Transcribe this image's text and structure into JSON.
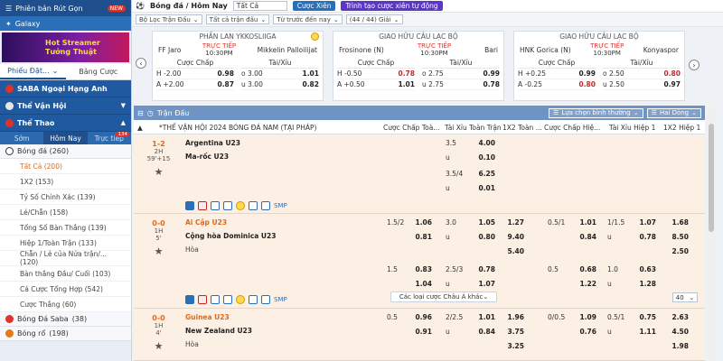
{
  "sidebar": {
    "top_label": "Phiên bản Rút Gọn",
    "top_badge": "NEW",
    "galaxy_label": "Galaxy",
    "banner_line1": "Hot Streamer",
    "banner_line2": "Tưởng Thuật",
    "tabs": [
      {
        "label": "Phiếu Đặt..."
      },
      {
        "label": "Bảng Cược"
      }
    ],
    "groups": [
      {
        "label": "SABA Ngoại Hạng Anh"
      },
      {
        "label": "Thể Vận Hội"
      },
      {
        "label": "Thể Thao"
      }
    ],
    "subtabs": [
      {
        "label": "Sớm"
      },
      {
        "label": "Hôm Nay"
      },
      {
        "label": "Trực tiếp",
        "badge": "134"
      }
    ],
    "sport_main": "Bóng đá (260)",
    "items": [
      {
        "label": "Tất Cả (200)"
      },
      {
        "label": "1X2 (153)"
      },
      {
        "label": "Tỷ Số Chính Xác (139)"
      },
      {
        "label": "Lẻ/Chẵn (158)"
      },
      {
        "label": "Tổng Số Bàn Thắng (139)"
      },
      {
        "label": "Hiệp 1/Toàn Trận (133)"
      },
      {
        "label": "Chẵn / Lẻ của Nửa trận/... (120)"
      },
      {
        "label": "Bàn thắng Đầu/ Cuối (103)"
      },
      {
        "label": "Cá Cược Tổng Hợp (542)"
      },
      {
        "label": "Cược Thắng (60)"
      }
    ],
    "other_sports": [
      {
        "label": "Bóng Đá Saba",
        "count": "(38)"
      },
      {
        "label": "Bóng rổ",
        "count": "(198)"
      }
    ]
  },
  "topbar": {
    "title": "Bóng đá / Hôm Nay",
    "select_all": "Tất Cả",
    "btn_parlay": "Cược Xiên",
    "btn_auto": "Trình tạo cược xiên tự động"
  },
  "filters": {
    "league_filter": "Bộ Lọc Trận Đấu",
    "all_matches": "Tất cả trận đấu",
    "sort": "Từ trước đến nay",
    "count": "(44 / 44) Giải"
  },
  "cards": [
    {
      "league": "PHẦN LAN YKKOSLIIGA",
      "home": "FF Jaro",
      "away": "Mikkelin Palloilijat",
      "live": "TRỰC TIẾP",
      "time": "10:30PM",
      "hdr_hcp": "Cược Chấp",
      "hdr_ou": "Tài/Xỉu",
      "rows": [
        {
          "a": "H -2.00",
          "b": "0.98",
          "c": "o 3.00",
          "d": "1.01"
        },
        {
          "a": "A +2.00",
          "b": "0.87",
          "c": "u 3.00",
          "d": "0.82"
        }
      ]
    },
    {
      "league": "GIAO HỮU CÂU LẠC BỘ",
      "home": "Frosinone (N)",
      "away": "Bari",
      "live": "TRỰC TIẾP",
      "time": "10:30PM",
      "hdr_hcp": "Cược Chấp",
      "hdr_ou": "Tài/Xỉu",
      "rows": [
        {
          "a": "H -0.50",
          "b": "0.78",
          "c": "o 2.75",
          "d": "0.99"
        },
        {
          "a": "A +0.50",
          "b": "1.01",
          "c": "u 2.75",
          "d": "0.78"
        }
      ]
    },
    {
      "league": "GIAO HỮU CÂU LẠC BỘ",
      "home": "HNK Gorica (N)",
      "away": "Konyaspor",
      "live": "TRỰC TIẾP",
      "time": "10:30PM",
      "hdr_hcp": "Cược Chấp",
      "hdr_ou": "Tài/Xỉu",
      "rows": [
        {
          "a": "H +0.25",
          "b": "0.99",
          "c": "o 2.50",
          "d": "0.80"
        },
        {
          "a": "A -0.25",
          "b": "0.80",
          "c": "u 2.50",
          "d": "0.97"
        }
      ]
    }
  ],
  "table": {
    "bar_title": "Trận Đấu",
    "odds_type": "Lựa chọn bình thường",
    "rows_sel": "Hai Dòng",
    "league": "*THẾ VẬN HỘI 2024 BÓNG ĐÁ NAM (TẠI PHÁP)",
    "col_hcp": "Cược Chấp Toà...",
    "col_ou": "Tài Xỉu Toàn Trận",
    "col_1x2": "1X2 Toàn ...",
    "col_hcp1": "Cược Chấp Hiệ...",
    "col_ou1": "Tài Xỉu Hiệp 1",
    "col_1x21": "1X2 Hiệp 1",
    "smp": "SMP",
    "more_label": "Các loại cược Châu Á khác",
    "pager": "40"
  },
  "matches": [
    {
      "score": "1-2",
      "half": "2H",
      "time": "59'+15",
      "home": "Argentina U23",
      "away": "Ma-rốc U23",
      "draw": "",
      "lines": [
        {
          "ou_l": "3.5",
          "ou_o": "4.00"
        },
        {
          "ou_l": "u",
          "ou_o": "0.10"
        },
        {
          "ou_l": "3.5/4",
          "ou_o": "6.25"
        },
        {
          "ou_l": "u",
          "ou_o": "0.01"
        }
      ]
    },
    {
      "score": "0-0",
      "half": "1H",
      "time": "5'",
      "home": "Ai Cập U23",
      "away": "Cộng hòa Dominica U23",
      "draw": "Hòa",
      "r1": {
        "hl": "1.5/2",
        "ho": "1.06",
        "ol": "3.0",
        "oo": "1.05",
        "x": "1.27",
        "h1l": "0.5/1",
        "h1o": "1.01",
        "o1l": "1/1.5",
        "o1o": "1.07",
        "x1": "1.68"
      },
      "r2": {
        "ho": "0.81",
        "ol": "u",
        "oo": "0.80",
        "x": "9.40",
        "h1o": "0.84",
        "o1l": "u",
        "o1o": "0.78",
        "x1": "8.50"
      },
      "r3": {
        "x": "5.40",
        "x1": "2.50"
      },
      "r4": {
        "hl": "1.5",
        "ho": "0.83",
        "ol": "2.5/3",
        "oo": "0.78",
        "h1l": "0.5",
        "h1o": "0.68",
        "o1l": "1.0",
        "o1o": "0.63"
      },
      "r5": {
        "ho": "1.04",
        "ol": "u",
        "oo": "1.07",
        "h1o": "1.22",
        "o1l": "u",
        "o1o": "1.28"
      }
    },
    {
      "score": "0-0",
      "half": "1H",
      "time": "4'",
      "home": "Guinea U23",
      "away": "New Zealand U23",
      "draw": "Hòa",
      "r1": {
        "hl": "0.5",
        "ho": "0.96",
        "ol": "2/2.5",
        "oo": "1.01",
        "x": "1.96",
        "h1l": "0/0.5",
        "h1o": "1.09",
        "o1l": "0.5/1",
        "o1o": "0.75",
        "x1": "2.63"
      },
      "r2": {
        "ho": "0.91",
        "ol": "u",
        "oo": "0.84",
        "x": "3.75",
        "h1o": "0.76",
        "o1l": "u",
        "o1o": "1.11",
        "x1": "4.50"
      },
      "r3": {
        "x": "3.25",
        "x1": "1.98"
      }
    }
  ]
}
